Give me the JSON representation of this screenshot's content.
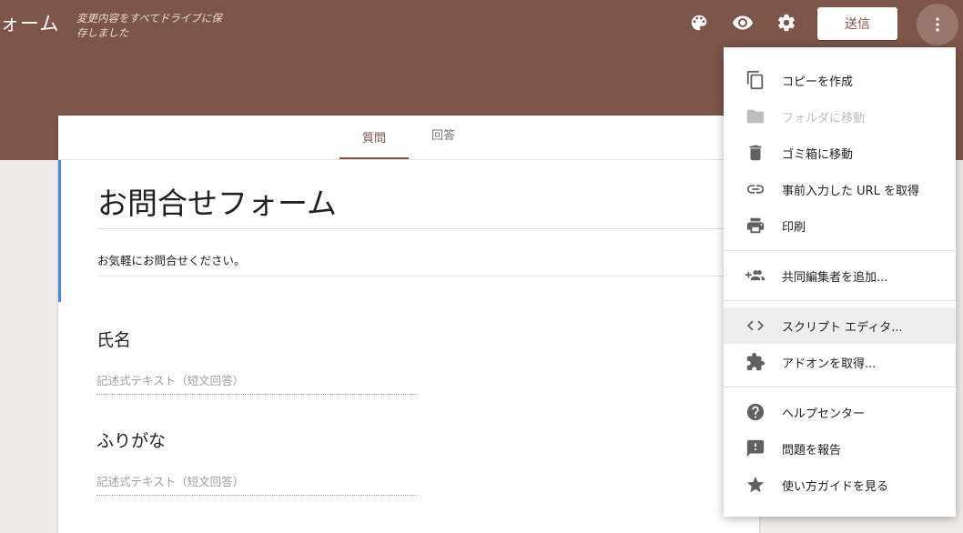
{
  "app": {
    "title": "ォーム",
    "save_status": "変更内容をすべてドライブに保存しました",
    "send_label": "送信",
    "icons": [
      "palette-icon",
      "preview-icon",
      "settings-icon",
      "more-vert-icon"
    ]
  },
  "tabs": [
    {
      "label": "質問",
      "active": true
    },
    {
      "label": "回答",
      "active": false
    }
  ],
  "form": {
    "title": "お問合せフォーム",
    "description": "お気軽にお問合せください。",
    "questions": [
      {
        "title": "氏名",
        "placeholder": "記述式テキスト（短文回答）"
      },
      {
        "title": "ふりがな",
        "placeholder": "記述式テキスト（短文回答）"
      }
    ]
  },
  "menu": {
    "groups": [
      [
        {
          "label": "コピーを作成",
          "icon": "copy-icon"
        },
        {
          "label": "フォルダに移動",
          "icon": "folder-icon",
          "disabled": true
        },
        {
          "label": "ゴミ箱に移動",
          "icon": "trash-icon"
        },
        {
          "label": "事前入力した URL を取得",
          "icon": "link-icon"
        },
        {
          "label": "印刷",
          "icon": "print-icon"
        }
      ],
      [
        {
          "label": "共同編集者を追加...",
          "icon": "add-people-icon"
        }
      ],
      [
        {
          "label": "スクリプト エディタ...",
          "icon": "code-icon",
          "highlighted": true
        },
        {
          "label": "アドオンを取得...",
          "icon": "puzzle-icon"
        }
      ],
      [
        {
          "label": "ヘルプセンター",
          "icon": "help-icon"
        },
        {
          "label": "問題を報告",
          "icon": "feedback-icon"
        },
        {
          "label": "使い方ガイドを見る",
          "icon": "star-icon"
        }
      ]
    ]
  },
  "colors": {
    "theme": "#7d5549",
    "background": "#efebe9",
    "accent_border": "#4285f4"
  }
}
